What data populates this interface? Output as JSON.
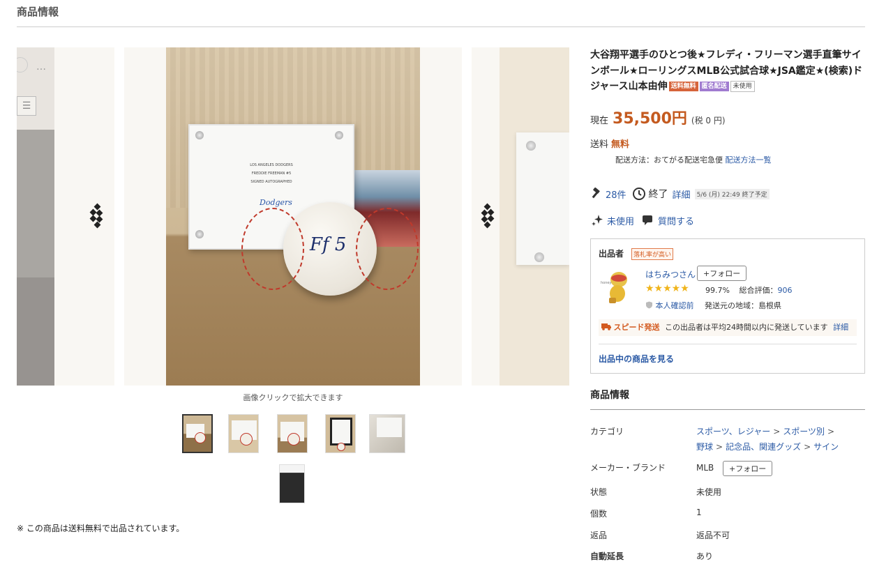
{
  "section_heading": "商品情報",
  "gallery": {
    "caption": "画像クリックで拡大できます",
    "main_card_lines": [
      "LOS ANGELES DODGERS",
      "FREDDIE FREEMAN #5",
      "SIGNED AUTOGRAPHED"
    ],
    "card_logo": "Dodgers",
    "signature": "Ff 5",
    "prev_dots": "…",
    "prev_menu": "☰"
  },
  "note": "※ この商品は送料無料で出品されています。",
  "item": {
    "title": "大谷翔平選手のひとつ後★フレディ・フリーマン選手直筆サインボール★ローリングスMLB公式試合球★JSA鑑定★(検索)ドジャース山本由伸",
    "badges": {
      "free_shipping": "送料無料",
      "anonymous": "匿名配送",
      "unused": "未使用"
    },
    "price_label": "現在",
    "price": "35,500円",
    "tax": "(税 0 円)",
    "shipping_label": "送料",
    "shipping_value": "無料",
    "shipping_method": "配送方法：おてがる配送宅急便",
    "shipping_link": "配送方法一覧",
    "bids": "28件",
    "end_status": "終了",
    "end_detail_link": "詳細",
    "end_date": "5/6 (月) 22:49 終了予定",
    "condition_tag": "未使用",
    "question_link": "質問する"
  },
  "seller": {
    "title": "出品者",
    "flag": "落札率が高い",
    "name": "はちみつさん",
    "follow": "+フォロー",
    "stars": "★★★★★",
    "positive": "99.7%",
    "total_label": "総合評価：",
    "total": "906",
    "verify": "本人確認前",
    "origin": "発送元の地域：島根県",
    "speed_label": "スピード発送",
    "speed_text": "この出品者は平均24時間以内に発送しています",
    "speed_link": "詳細",
    "items_link": "出品中の商品を見る"
  },
  "info": {
    "heading": "商品情報",
    "category_label": "カテゴリ",
    "categories": [
      "スポーツ、レジャー",
      "スポーツ別",
      "野球",
      "記念品、関連グッズ",
      "サイン"
    ],
    "brand_label": "メーカー・ブランド",
    "brand": "MLB",
    "brand_follow": "+フォロー",
    "condition_label": "状態",
    "condition": "未使用",
    "quantity_label": "個数",
    "quantity": "1",
    "return_label": "返品",
    "return": "返品不可",
    "auto_extend_label": "自動延長",
    "auto_extend": "あり"
  },
  "colors": {
    "price": "#c45a1f",
    "link": "#2b5aa5",
    "star": "#f0b41a"
  }
}
